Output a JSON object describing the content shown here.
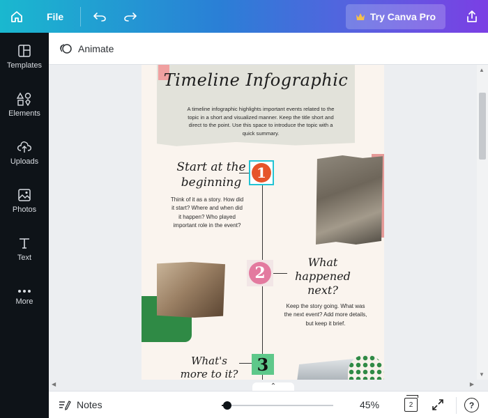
{
  "topbar": {
    "file_label": "File",
    "try_pro_label": "Try Canva Pro",
    "home_icon": "home-icon",
    "undo_icon": "undo-icon",
    "redo_icon": "redo-icon",
    "crown_icon": "crown-icon",
    "share_icon": "share-icon",
    "colors": {
      "gradient_start": "#1ab8cf",
      "gradient_end": "#7b3fe4",
      "crown": "#f5c04a"
    }
  },
  "sidebar": {
    "items": [
      {
        "label": "Templates",
        "icon": "templates-icon"
      },
      {
        "label": "Elements",
        "icon": "elements-icon"
      },
      {
        "label": "Uploads",
        "icon": "uploads-icon"
      },
      {
        "label": "Photos",
        "icon": "photos-icon"
      },
      {
        "label": "Text",
        "icon": "text-icon"
      },
      {
        "label": "More",
        "icon": "more-icon"
      }
    ]
  },
  "toolbar": {
    "animate_label": "Animate",
    "animate_icon": "animate-icon"
  },
  "design": {
    "title": "Timeline Infographic",
    "intro": "A timeline infographic highlights important events related to the topic in a short and visualized manner. Keep the title short and direct to the point. Use this space to introduce the topic with a quick summary.",
    "events": [
      {
        "number": "1",
        "heading": "Start at the beginning",
        "text": "Think of it as a story. How did it start? Where and when did it happen? Who played important role in the event?"
      },
      {
        "number": "2",
        "heading": "What happened next?",
        "text": "Keep the story going. What was the next event? Add more details, but keep it brief."
      },
      {
        "number": "3",
        "heading": "What's more to it?"
      }
    ]
  },
  "footer": {
    "notes_label": "Notes",
    "notes_icon": "notes-icon",
    "zoom_percent": "45%",
    "zoom_level": 0.05,
    "page_count": "2",
    "fullscreen_icon": "fullscreen-icon",
    "help_label": "?"
  }
}
